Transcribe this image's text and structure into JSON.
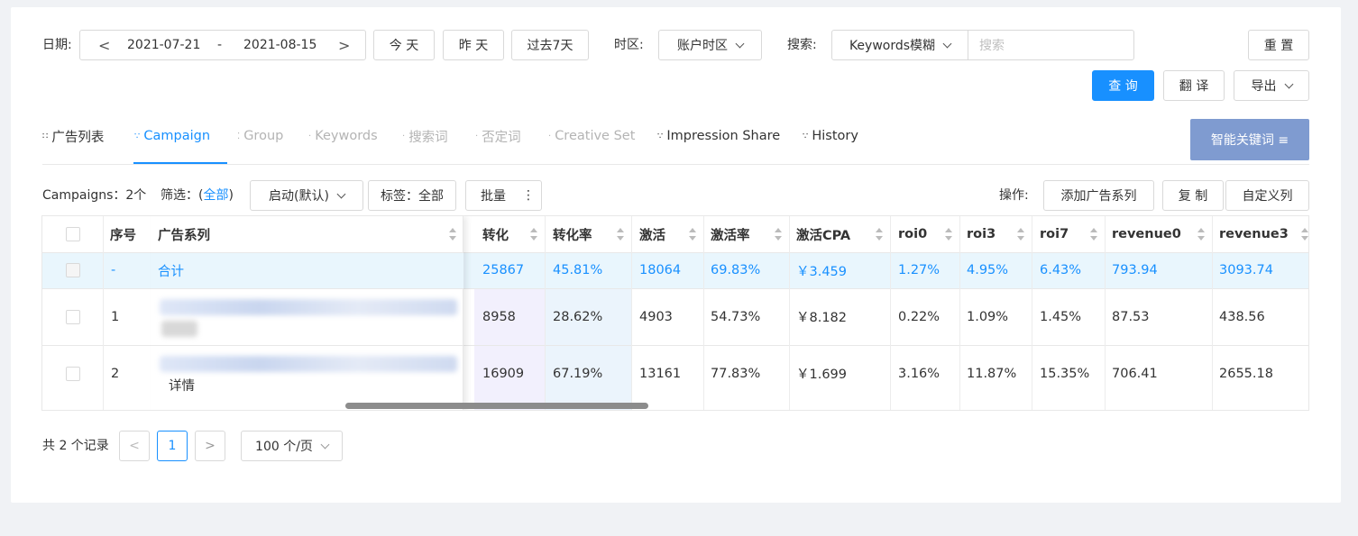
{
  "filters": {
    "date_label": "日期:",
    "date_start": "2021-07-21",
    "date_sep": "-",
    "date_end": "2021-08-15",
    "today": "今 天",
    "yesterday": "昨 天",
    "past7": "过去7天",
    "tz_label": "时区:",
    "tz_value": "账户时区",
    "search_label": "搜索:",
    "search_mode": "Keywords模糊",
    "search_placeholder": "搜索",
    "reset": "重 置",
    "query": "查 询",
    "translate": "翻 译",
    "export": "导出"
  },
  "tabs": [
    {
      "label": "广告列表",
      "state": "normal"
    },
    {
      "label": "Campaign",
      "state": "active"
    },
    {
      "label": "Group",
      "state": "disabled"
    },
    {
      "label": "Keywords",
      "state": "disabled"
    },
    {
      "label": "搜索词",
      "state": "disabled"
    },
    {
      "label": "否定词",
      "state": "disabled"
    },
    {
      "label": "Creative Set",
      "state": "disabled"
    },
    {
      "label": "Impression Share",
      "state": "normal"
    },
    {
      "label": "History",
      "state": "normal"
    }
  ],
  "smart_keywords": "智能关键词 ≡",
  "toolbar": {
    "campaigns_count": "Campaigns：2个",
    "filter_label": "筛选：(",
    "filter_all": "全部",
    "filter_close": ")",
    "status_select": "启动(默认)",
    "tag_filter": "标签：全部",
    "batch": "批量",
    "batch_more": "⋮",
    "ops_label": "操作:",
    "add_series": "添加广告系列",
    "copy": "复 制",
    "custom_cols": "自定义列"
  },
  "table": {
    "headers": {
      "index": "序号",
      "series": "广告系列",
      "conv": "转化",
      "conv_rate": "转化率",
      "act": "激活",
      "act_rate": "激活率",
      "act_cpa": "激活CPA",
      "roi0": "roi0",
      "roi3": "roi3",
      "roi7": "roi7",
      "rev0": "revenue0",
      "rev3": "revenue3"
    },
    "total": {
      "index": "-",
      "series": "合计",
      "conv": "25867",
      "conv_rate": "45.81%",
      "act": "18064",
      "act_rate": "69.83%",
      "act_cpa": "￥3.459",
      "roi0": "1.27%",
      "roi3": "4.95%",
      "roi7": "6.43%",
      "rev0": "793.94",
      "rev3": "3093.74"
    },
    "rows": [
      {
        "index": "1",
        "detail": "",
        "conv": "8958",
        "conv_rate": "28.62%",
        "act": "4903",
        "act_rate": "54.73%",
        "act_cpa": "￥8.182",
        "roi0": "0.22%",
        "roi3": "1.09%",
        "roi7": "1.45%",
        "rev0": "87.53",
        "rev3": "438.56"
      },
      {
        "index": "2",
        "detail": "详情",
        "conv": "16909",
        "conv_rate": "67.19%",
        "act": "13161",
        "act_rate": "77.83%",
        "act_cpa": "￥1.699",
        "roi0": "3.16%",
        "roi3": "11.87%",
        "roi7": "15.35%",
        "rev0": "706.41",
        "rev3": "2655.18"
      }
    ]
  },
  "pagination": {
    "total": "共 2 个记录",
    "prev": "<",
    "page": "1",
    "next": ">",
    "page_size": "100 个/页"
  }
}
